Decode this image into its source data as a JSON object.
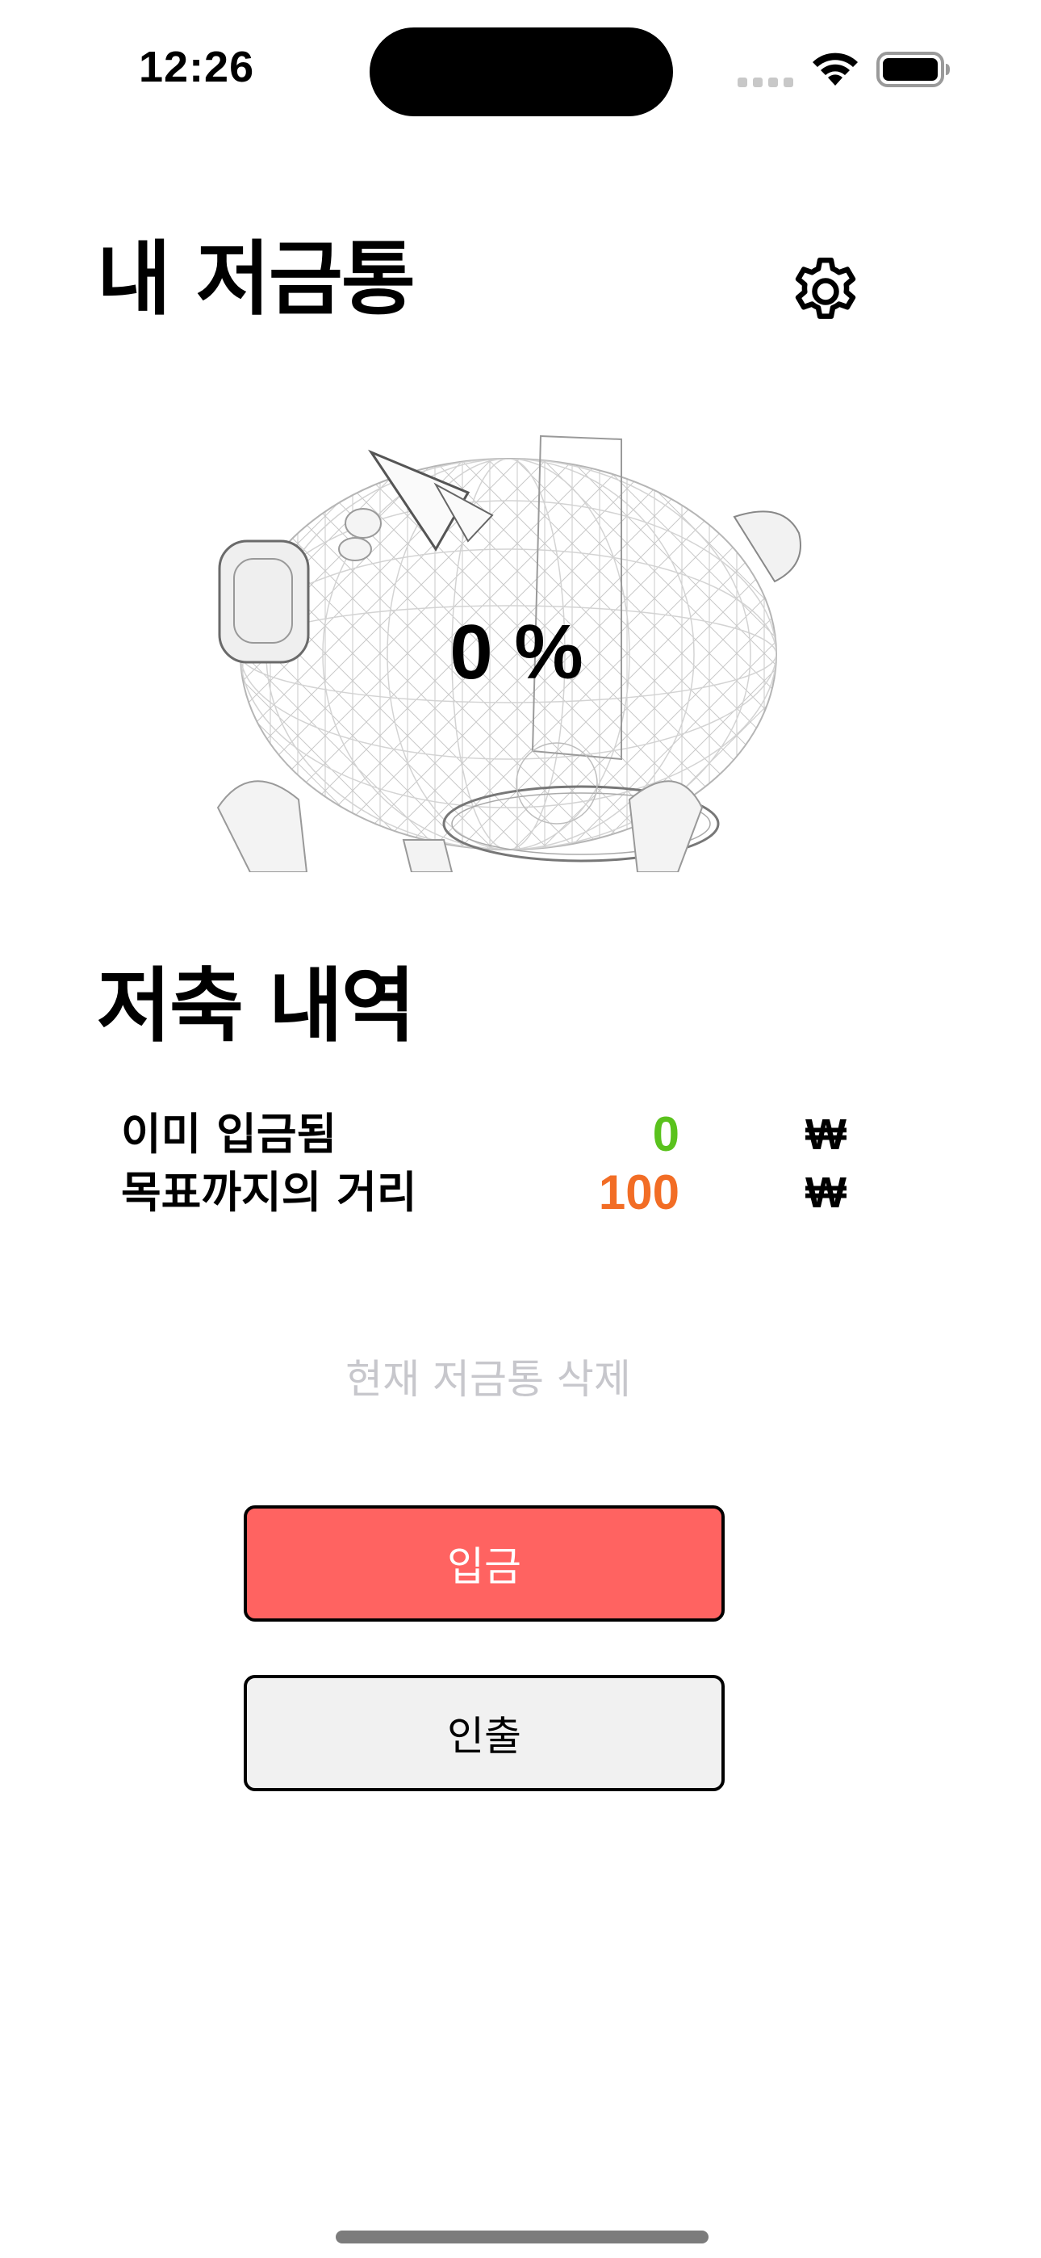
{
  "status_bar": {
    "time": "12:26"
  },
  "header": {
    "title": "내 저금통",
    "settings_icon": "gear-icon"
  },
  "piggy": {
    "progress_text": "0 %",
    "progress_percent": 0
  },
  "history": {
    "title": "저축 내역",
    "rows": [
      {
        "label": "이미 입금됨",
        "value": "0",
        "currency": "₩",
        "color": "#5ac21d"
      },
      {
        "label": "목표까지의 거리",
        "value": "100",
        "currency": "₩",
        "color": "#f26d25"
      }
    ]
  },
  "actions": {
    "delete_label": "현재 저금통 삭제",
    "deposit_label": "입금",
    "withdraw_label": "인출"
  },
  "colors": {
    "deposit_bg": "#ff6361",
    "withdraw_bg": "#f1f1f1",
    "delete_text": "#c7c7cc"
  }
}
